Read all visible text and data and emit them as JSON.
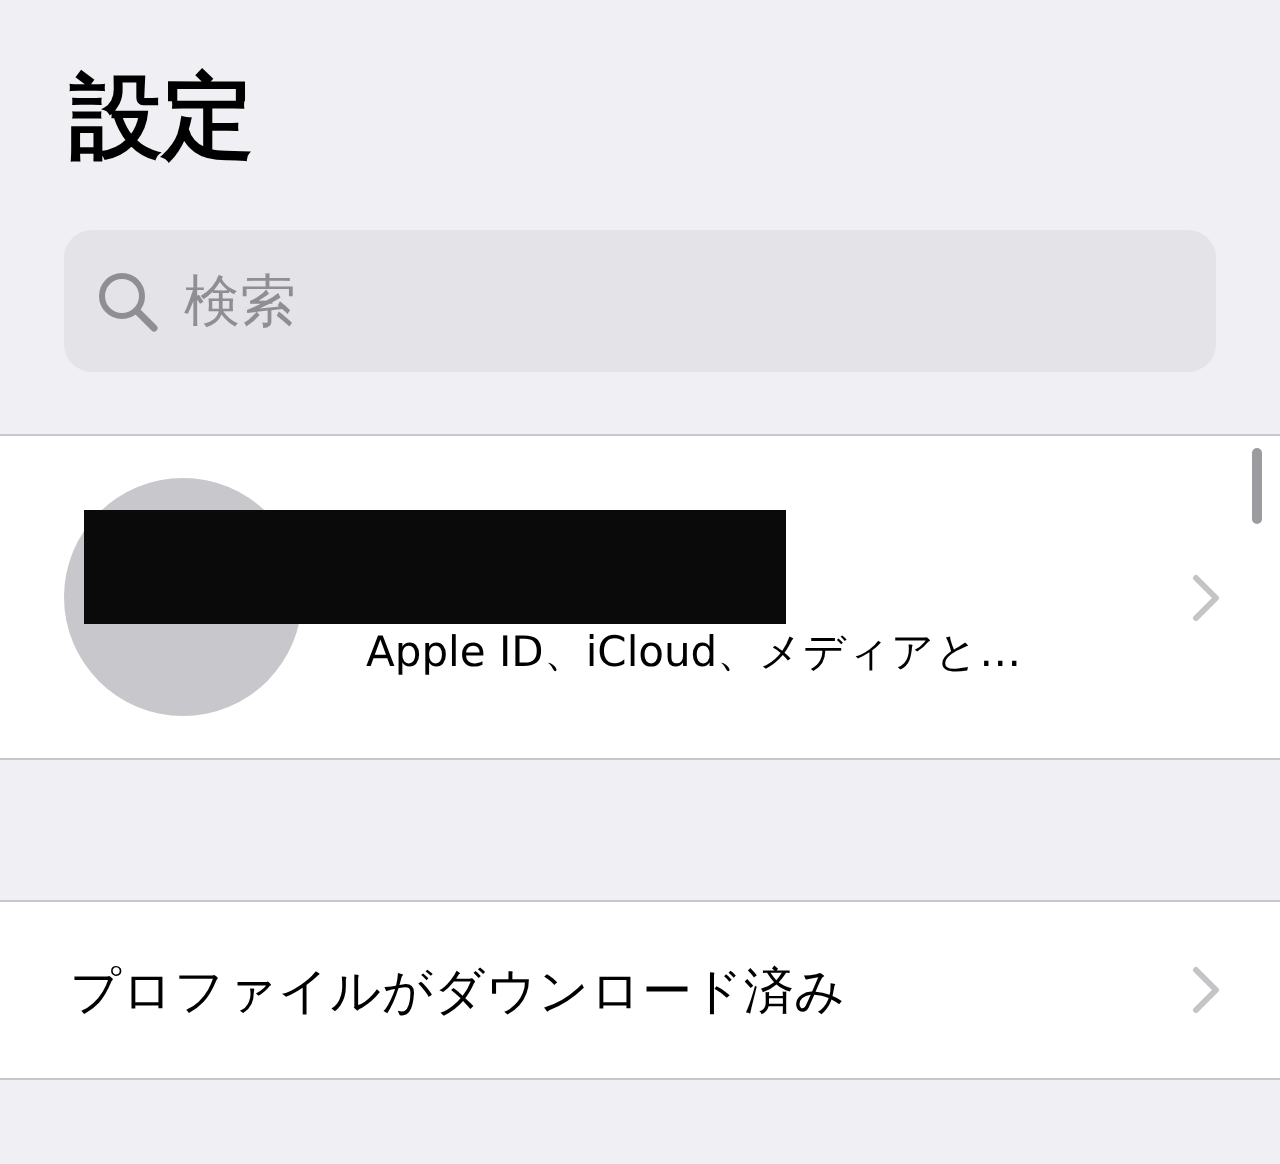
{
  "title": "設定",
  "search": {
    "placeholder": "検索"
  },
  "account": {
    "subtitle": "Apple ID、iCloud、メディアと…"
  },
  "rows": [
    {
      "label": "プロファイルがダウンロード済み"
    }
  ]
}
